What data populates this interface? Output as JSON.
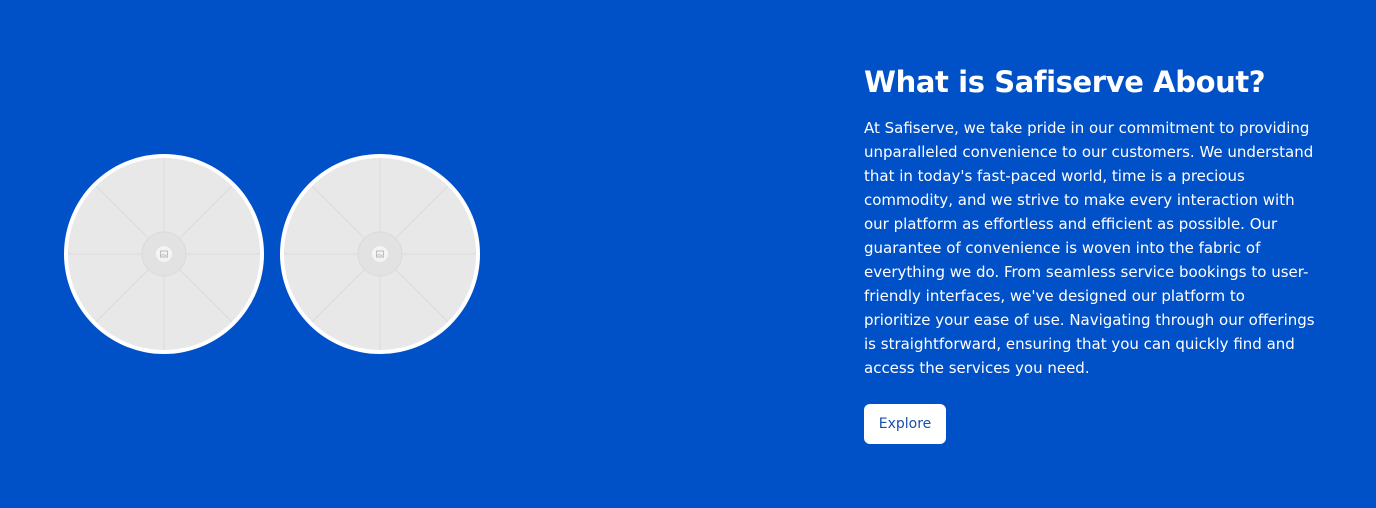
{
  "about": {
    "title": "What is Safiserve About?",
    "description": "At Safiserve, we take pride in our commitment to providing unparalleled convenience to our customers. We understand that in today's fast-paced world, time is a precious commodity, and we strive to make every interaction with our platform as effortless and efficient as possible. Our guarantee of convenience is woven into the fabric of everything we do. From seamless service bookings to user-friendly interfaces, we've designed our platform to prioritize your ease of use. Navigating through our offerings is straightforward, ensuring that you can quickly find and access the services you need.",
    "explore_label": "Explore"
  },
  "images": [
    {
      "icon": "image-placeholder-icon"
    },
    {
      "icon": "image-placeholder-icon"
    }
  ],
  "colors": {
    "background": "#0050c8",
    "button_background": "#ffffff",
    "button_text": "#1a4fa8",
    "placeholder": "#e8e8e8"
  }
}
